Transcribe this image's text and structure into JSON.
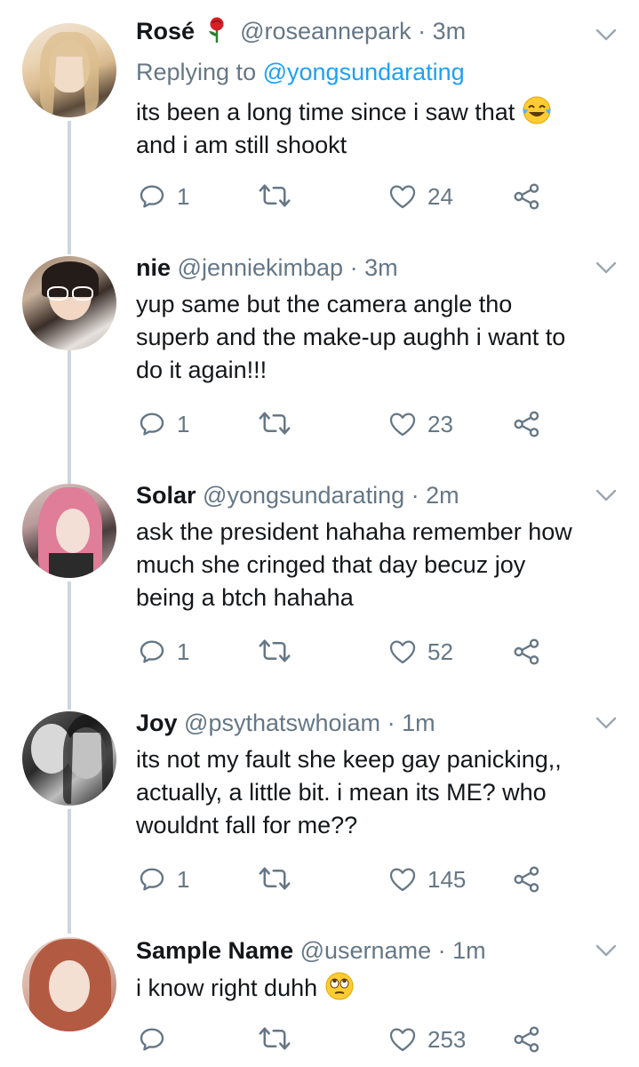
{
  "tweets": [
    {
      "name": "Rosé",
      "handle": "@roseannepark",
      "separator": "·",
      "time": "3m",
      "reply_label": "Replying to",
      "reply_handle": "@yongsundarating",
      "line1": "its been a long time since i saw that",
      "line2": "and i am still shookt",
      "replies": "1",
      "likes": "24",
      "name_emoji": "rose-emoji",
      "text_emoji": "tears-of-joy-emoji"
    },
    {
      "name": "nie",
      "handle": "@jenniekimbap",
      "separator": "·",
      "time": "3m",
      "line1": "yup same but the camera angle tho",
      "line2": "superb and the make-up aughh i want to",
      "line3": "do it again!!!",
      "replies": "1",
      "likes": "23"
    },
    {
      "name": "Solar",
      "handle": "@yongsundarating",
      "separator": "·",
      "time": "2m",
      "line1": "ask the president hahaha remember how",
      "line2": "much she cringed that day becuz joy",
      "line3": "being a btch hahaha",
      "replies": "1",
      "likes": "52"
    },
    {
      "name": "Joy",
      "handle": "@psythatswhoiam",
      "separator": "·",
      "time": "1m",
      "line1": "its not my fault she keep gay panicking,,",
      "line2": "actually, a little bit. i mean its ME? who",
      "line3": "wouldnt fall for me??",
      "replies": "1",
      "likes": "145"
    },
    {
      "name": "Sample Name",
      "handle": "@username",
      "separator": "·",
      "time": "1m",
      "line1": "i know right duhh",
      "likes": "253",
      "text_emoji": "eye-roll-emoji"
    }
  ],
  "colors": {
    "text": "#14171a",
    "secondary": "#657786",
    "link": "#1da1f2",
    "thread_line": "#ccd6dd",
    "rose_red": "#d61f26"
  },
  "icons": [
    "reply-icon",
    "retweet-icon",
    "like-icon",
    "share-icon",
    "chevron-down-icon"
  ]
}
